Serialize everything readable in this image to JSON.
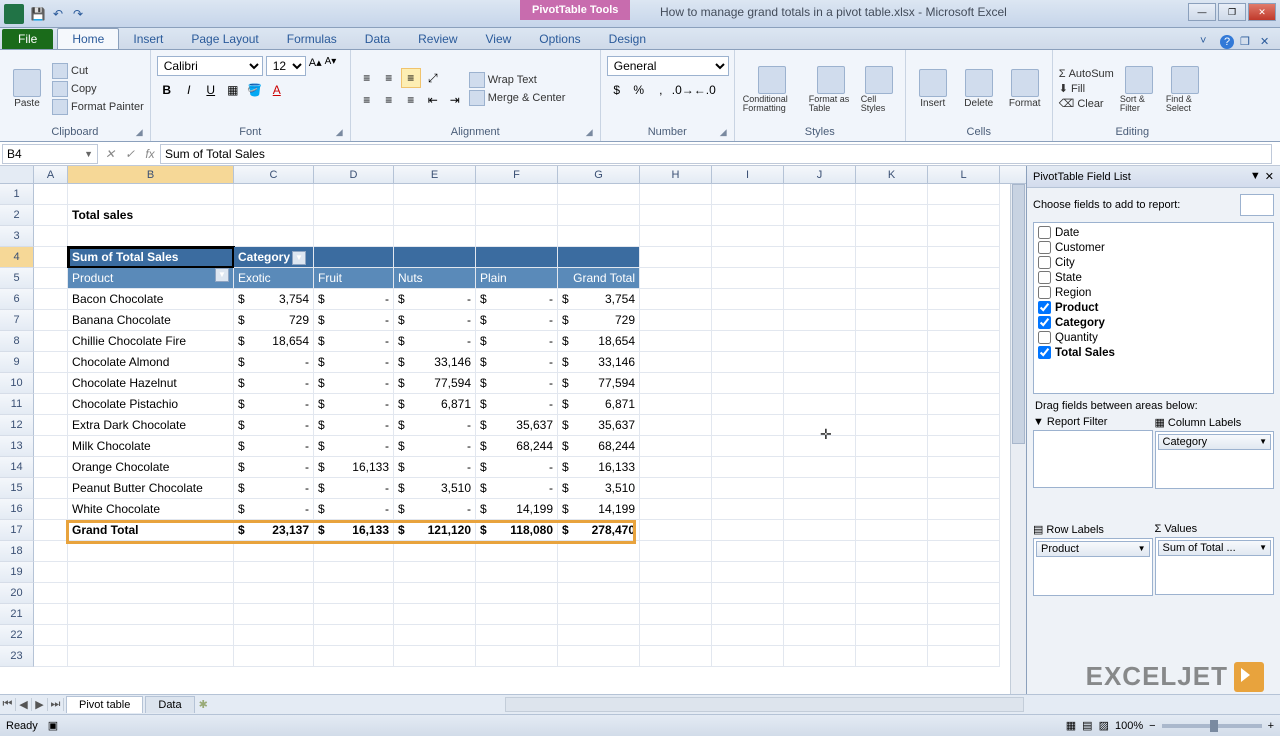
{
  "title": {
    "tools": "PivotTable Tools",
    "doc": "How to manage grand totals in a pivot table.xlsx - Microsoft Excel"
  },
  "tabs": {
    "file": "File",
    "list": [
      "Home",
      "Insert",
      "Page Layout",
      "Formulas",
      "Data",
      "Review",
      "View",
      "Options",
      "Design"
    ],
    "active": 0
  },
  "ribbon": {
    "clipboard": {
      "paste": "Paste",
      "cut": "Cut",
      "copy": "Copy",
      "painter": "Format Painter",
      "label": "Clipboard"
    },
    "font": {
      "name": "Calibri",
      "size": "12",
      "label": "Font"
    },
    "alignment": {
      "wrap": "Wrap Text",
      "merge": "Merge & Center",
      "label": "Alignment"
    },
    "number": {
      "format": "General",
      "label": "Number"
    },
    "styles": {
      "cond": "Conditional Formatting",
      "table": "Format as Table",
      "cell": "Cell Styles",
      "label": "Styles"
    },
    "cells": {
      "insert": "Insert",
      "delete": "Delete",
      "format": "Format",
      "label": "Cells"
    },
    "editing": {
      "autosum": "AutoSum",
      "fill": "Fill",
      "clear": "Clear",
      "sort": "Sort & Filter",
      "find": "Find & Select",
      "label": "Editing"
    }
  },
  "formula": {
    "cellref": "B4",
    "value": "Sum of Total Sales"
  },
  "columns": [
    "A",
    "B",
    "C",
    "D",
    "E",
    "F",
    "G",
    "H",
    "I",
    "J",
    "K",
    "L"
  ],
  "sheet": {
    "title_cell": "Total sales",
    "pivot_label": "Sum of Total Sales",
    "category_label": "Category",
    "product_label": "Product",
    "col_headers": [
      "Exotic",
      "Fruit",
      "Nuts",
      "Plain",
      "Grand Total"
    ],
    "rows": [
      {
        "n": "Bacon Chocolate",
        "v": [
          "3,754",
          "-",
          "-",
          "-",
          "3,754"
        ]
      },
      {
        "n": "Banana Chocolate",
        "v": [
          "729",
          "-",
          "-",
          "-",
          "729"
        ]
      },
      {
        "n": "Chillie Chocolate Fire",
        "v": [
          "18,654",
          "-",
          "-",
          "-",
          "18,654"
        ]
      },
      {
        "n": "Chocolate Almond",
        "v": [
          "-",
          "-",
          "33,146",
          "-",
          "33,146"
        ]
      },
      {
        "n": "Chocolate Hazelnut",
        "v": [
          "-",
          "-",
          "77,594",
          "-",
          "77,594"
        ]
      },
      {
        "n": "Chocolate Pistachio",
        "v": [
          "-",
          "-",
          "6,871",
          "-",
          "6,871"
        ]
      },
      {
        "n": "Extra Dark Chocolate",
        "v": [
          "-",
          "-",
          "-",
          "35,637",
          "35,637"
        ]
      },
      {
        "n": "Milk Chocolate",
        "v": [
          "-",
          "-",
          "-",
          "68,244",
          "68,244"
        ]
      },
      {
        "n": "Orange Chocolate",
        "v": [
          "-",
          "16,133",
          "-",
          "-",
          "16,133"
        ]
      },
      {
        "n": "Peanut Butter Chocolate",
        "v": [
          "-",
          "-",
          "3,510",
          "-",
          "3,510"
        ]
      },
      {
        "n": "White Chocolate",
        "v": [
          "-",
          "-",
          "-",
          "14,199",
          "14,199"
        ]
      }
    ],
    "grand_row": {
      "n": "Grand Total",
      "v": [
        "23,137",
        "16,133",
        "121,120",
        "118,080",
        "278,470"
      ]
    }
  },
  "fieldlist": {
    "title": "PivotTable Field List",
    "choose": "Choose fields to add to report:",
    "fields": [
      {
        "name": "Date",
        "checked": false
      },
      {
        "name": "Customer",
        "checked": false
      },
      {
        "name": "City",
        "checked": false
      },
      {
        "name": "State",
        "checked": false
      },
      {
        "name": "Region",
        "checked": false
      },
      {
        "name": "Product",
        "checked": true
      },
      {
        "name": "Category",
        "checked": true
      },
      {
        "name": "Quantity",
        "checked": false
      },
      {
        "name": "Total Sales",
        "checked": true
      }
    ],
    "drag_label": "Drag fields between areas below:",
    "areas": {
      "filter": "Report Filter",
      "columns": "Column Labels",
      "rows": "Row Labels",
      "values": "Values",
      "col_pill": "Category",
      "row_pill": "Product",
      "val_pill": "Sum of Total ..."
    }
  },
  "sheettabs": {
    "active": "Pivot table",
    "other": "Data"
  },
  "status": {
    "ready": "Ready",
    "zoom": "100%"
  },
  "watermark": "EXCELJET"
}
